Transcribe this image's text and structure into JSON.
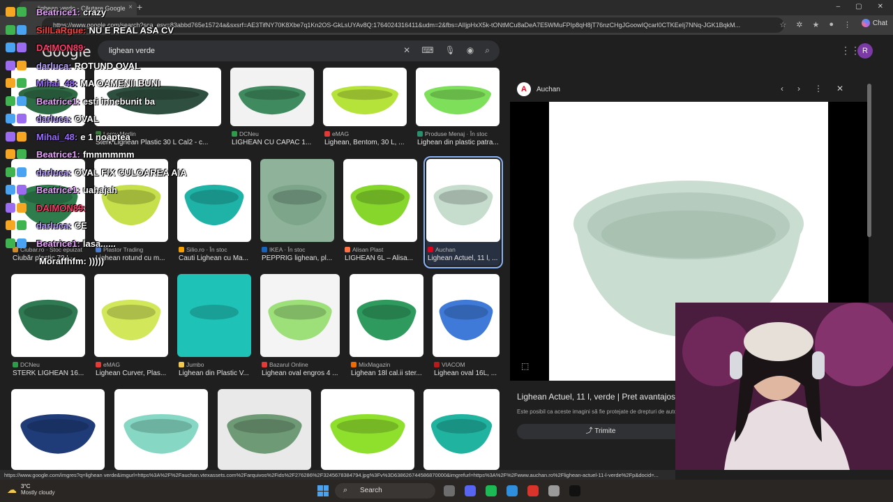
{
  "browser": {
    "tab_title": "lighean verde - Căutare Google",
    "tab_close": "×",
    "new_tab": "+",
    "url": "https://www.google.com/search?sca_esv=83abbd765e15724a&sxsrf=AE3TifNY70K8Xbe7q1Kn2OS-GkLsUYAv8Q:1764024316411&udm=2&fbs=AIIjpHxX5k-tONtMCu8aDeA7E5WMuFPIp8qH8jT76nzCHgJGoowIQcarl0CTKEeIj7NNq-JGK1BqkM...",
    "chat_label": "Chat",
    "controls": [
      "–",
      "▢",
      "✕"
    ]
  },
  "google": {
    "logo": "Google",
    "query": "lighean verde",
    "avatar_letter": "R"
  },
  "results": [
    {
      "source": "",
      "title": "",
      "color": "#2e6b45",
      "bg": "#ffffff"
    },
    {
      "source": "Leroy Merlin",
      "title": "Sterk Lighean Plastic 30 L Cal2 - c...",
      "color": "#2f4f40",
      "bg": "#ffffff"
    },
    {
      "source": "DCNeu",
      "title": "LIGHEAN CU CAPAC 1...",
      "color": "#3f8a5e",
      "bg": "#f2f2f2"
    },
    {
      "source": "eMAG",
      "title": "Lighean, Bentom, 30 L, ...",
      "color": "#b6e33a",
      "bg": "#ffffff"
    },
    {
      "source": "Produse Menaj · În stoc",
      "title": "Lighean din plastic patra...",
      "color": "#7ee05a",
      "bg": "#ffffff"
    },
    {
      "source": "Ciubar.ro · Stoc epuizat",
      "title": "Ciubăr plastic 70 L-...",
      "color": "#2f7d4c",
      "bg": "#ffffff"
    },
    {
      "source": "Plastor Trading",
      "title": "Lighean rotund cu m...",
      "color": "#c5e04a",
      "bg": "#ffffff"
    },
    {
      "source": "Silio.ro · În stoc",
      "title": "Cauti Lighean cu Ma...",
      "color": "#1fb3a8",
      "bg": "#ffffff"
    },
    {
      "source": "IKEA · În stoc",
      "title": "PEPPRIG lighean, pl...",
      "color": "#7da58a",
      "bg": "#8fb39a"
    },
    {
      "source": "Alisan Plast",
      "title": "LIGHEAN 6L – Alisa...",
      "color": "#86d62c",
      "bg": "#ffffff"
    },
    {
      "source": "Auchan",
      "title": "Lighean Actuel, 11 l, ...",
      "color": "#c6dccd",
      "bg": "#ffffff"
    },
    {
      "source": "DCNeu",
      "title": "STERK LIGHEAN 16...",
      "color": "#2f7a52",
      "bg": "#ffffff"
    },
    {
      "source": "eMAG",
      "title": "Lighean Curver, Plas...",
      "color": "#d2e85a",
      "bg": "#ffffff"
    },
    {
      "source": "Jumbo",
      "title": "Lighean din Plastic V...",
      "color": "#1fc2b6",
      "bg": "#1fc2b6"
    },
    {
      "source": "Bazarul Online",
      "title": "Lighean oval engros 4 ...",
      "color": "#9de07a",
      "bg": "#f4f4f4"
    },
    {
      "source": "MixMagazin",
      "title": "Lighean 18l cal.ii ster...",
      "color": "#2f9a5e",
      "bg": "#ffffff"
    },
    {
      "source": "VIACOM",
      "title": "Lighean oval 16L, ...",
      "color": "#3f7ad8",
      "bg": "#ffffff"
    },
    {
      "source": "",
      "title": "",
      "color": "#1f3b78",
      "bg": "#ffffff"
    },
    {
      "source": "",
      "title": "",
      "color": "#86d8c4",
      "bg": "#ffffff"
    },
    {
      "source": "",
      "title": "",
      "color": "#6f9a76",
      "bg": "#e9e9e9"
    },
    {
      "source": "",
      "title": "",
      "color": "#8fe02c",
      "bg": "#ffffff"
    },
    {
      "source": "",
      "title": "",
      "color": "#1fb3a0",
      "bg": "#ffffff"
    }
  ],
  "side_panel": {
    "site": "Auchan",
    "title": "Lighean Actuel, 11 l, verde | Pret avantajos -",
    "note": "Este posibil ca aceste imagini să fie protejate de drepturi de autor.",
    "share_label": "Trimite",
    "product_color": "#c9ddd0"
  },
  "chat": [
    {
      "user": "Beatrice1:",
      "text": "crazy",
      "color": "#e8a0ff"
    },
    {
      "user": "SillLaRgue:",
      "text": "NU E REAL ASA CV",
      "color": "#ff4040"
    },
    {
      "user": "DAIMON89:",
      "text": "",
      "color": "#ff3a6a"
    },
    {
      "user": "darluca:",
      "text": "ROTUND OVAL",
      "color": "#b9a0ff"
    },
    {
      "user": "Mihai_48:",
      "text": "MA OAMENII BUNI",
      "color": "#9a6cff"
    },
    {
      "user": "Beatrice1:",
      "text": "esti innebunit ba",
      "color": "#e8a0ff"
    },
    {
      "user": "darluca:",
      "text": "OVAL",
      "color": "#b9a0ff"
    },
    {
      "user": "Mihai_48:",
      "text": "e 1 noaptea",
      "color": "#9a6cff"
    },
    {
      "user": "Beatrice1:",
      "text": "fmmmmmm",
      "color": "#e8a0ff"
    },
    {
      "user": "darluca:",
      "text": "OVAL FIX CULOAREA AIA",
      "color": "#b9a0ff"
    },
    {
      "user": "Beatrice1:",
      "text": "uahajah",
      "color": "#e8a0ff"
    },
    {
      "user": "DAIMON89:",
      "text": "",
      "color": "#ff3a6a"
    },
    {
      "user": "darluca:",
      "text": "CE",
      "color": "#b9a0ff"
    },
    {
      "user": "Beatrice1:",
      "text": "lasa......",
      "color": "#e8a0ff"
    },
    {
      "user": "",
      "text": "Moraffhfm: )))))",
      "color": "#ffffff"
    }
  ],
  "status_url": "https://www.google.com/imgres?q=lighean verde&imgurl=https%3A%2F%2Fauchan.vtexassets.com%2Farquivos%2Fids%2F276286%2F3245678384794.jpg%3Fv%3D638626744586870000&imgrefurl=https%3A%2F%2Fwww.auchan.ro%2Flighean-actuel-11-l-verde%2Fp&docid=...",
  "taskbar": {
    "temp": "3°C",
    "weather": "Mostly cloudy",
    "search_label": "Search"
  }
}
